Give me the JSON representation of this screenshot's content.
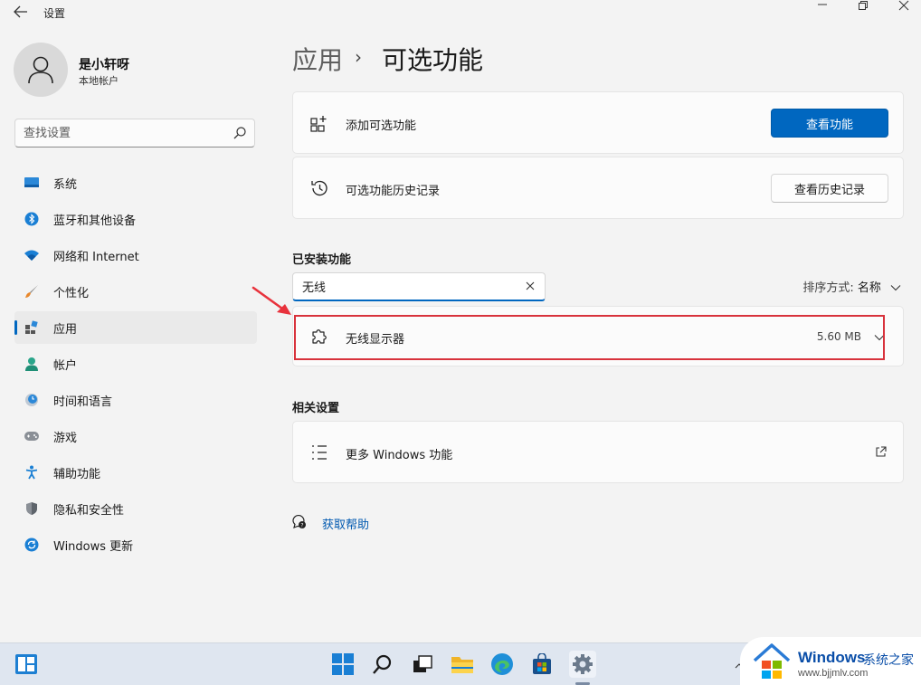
{
  "window": {
    "title": "设置",
    "back_icon": "back-arrow-icon",
    "controls": [
      "minimize-icon",
      "restore-icon",
      "close-icon"
    ]
  },
  "user": {
    "name": "是小轩呀",
    "account_type": "本地帐户"
  },
  "search": {
    "placeholder": "查找设置"
  },
  "sidebar": {
    "items": [
      {
        "label": "系统",
        "icon": "system-icon",
        "active": false
      },
      {
        "label": "蓝牙和其他设备",
        "icon": "bluetooth-icon",
        "active": false
      },
      {
        "label": "网络和 Internet",
        "icon": "wifi-icon",
        "active": false
      },
      {
        "label": "个性化",
        "icon": "brush-icon",
        "active": false
      },
      {
        "label": "应用",
        "icon": "apps-icon",
        "active": true
      },
      {
        "label": "帐户",
        "icon": "account-icon",
        "active": false
      },
      {
        "label": "时间和语言",
        "icon": "clock-globe-icon",
        "active": false
      },
      {
        "label": "游戏",
        "icon": "gamepad-icon",
        "active": false
      },
      {
        "label": "辅助功能",
        "icon": "accessibility-icon",
        "active": false
      },
      {
        "label": "隐私和安全性",
        "icon": "shield-icon",
        "active": false
      },
      {
        "label": "Windows 更新",
        "icon": "update-icon",
        "active": false
      }
    ]
  },
  "breadcrumb": {
    "parent": "应用",
    "separator": "›",
    "current": "可选功能"
  },
  "add_feature": {
    "label": "添加可选功能",
    "button": "查看功能"
  },
  "history": {
    "label": "可选功能历史记录",
    "button": "查看历史记录"
  },
  "installed": {
    "title": "已安装功能",
    "filter_value": "无线",
    "sort_prefix": "排序方式:",
    "sort_value": "名称",
    "items": [
      {
        "name": "无线显示器",
        "size": "5.60 MB"
      }
    ]
  },
  "related": {
    "title": "相关设置",
    "items": [
      {
        "label": "更多 Windows 功能"
      }
    ]
  },
  "help": {
    "label": "获取帮助"
  },
  "colors": {
    "accent": "#0067c0",
    "highlight": "#d8323c"
  },
  "watermark": {
    "title": "Windows",
    "subtitle": "系统之家",
    "url": "www.bjjmlv.com"
  }
}
